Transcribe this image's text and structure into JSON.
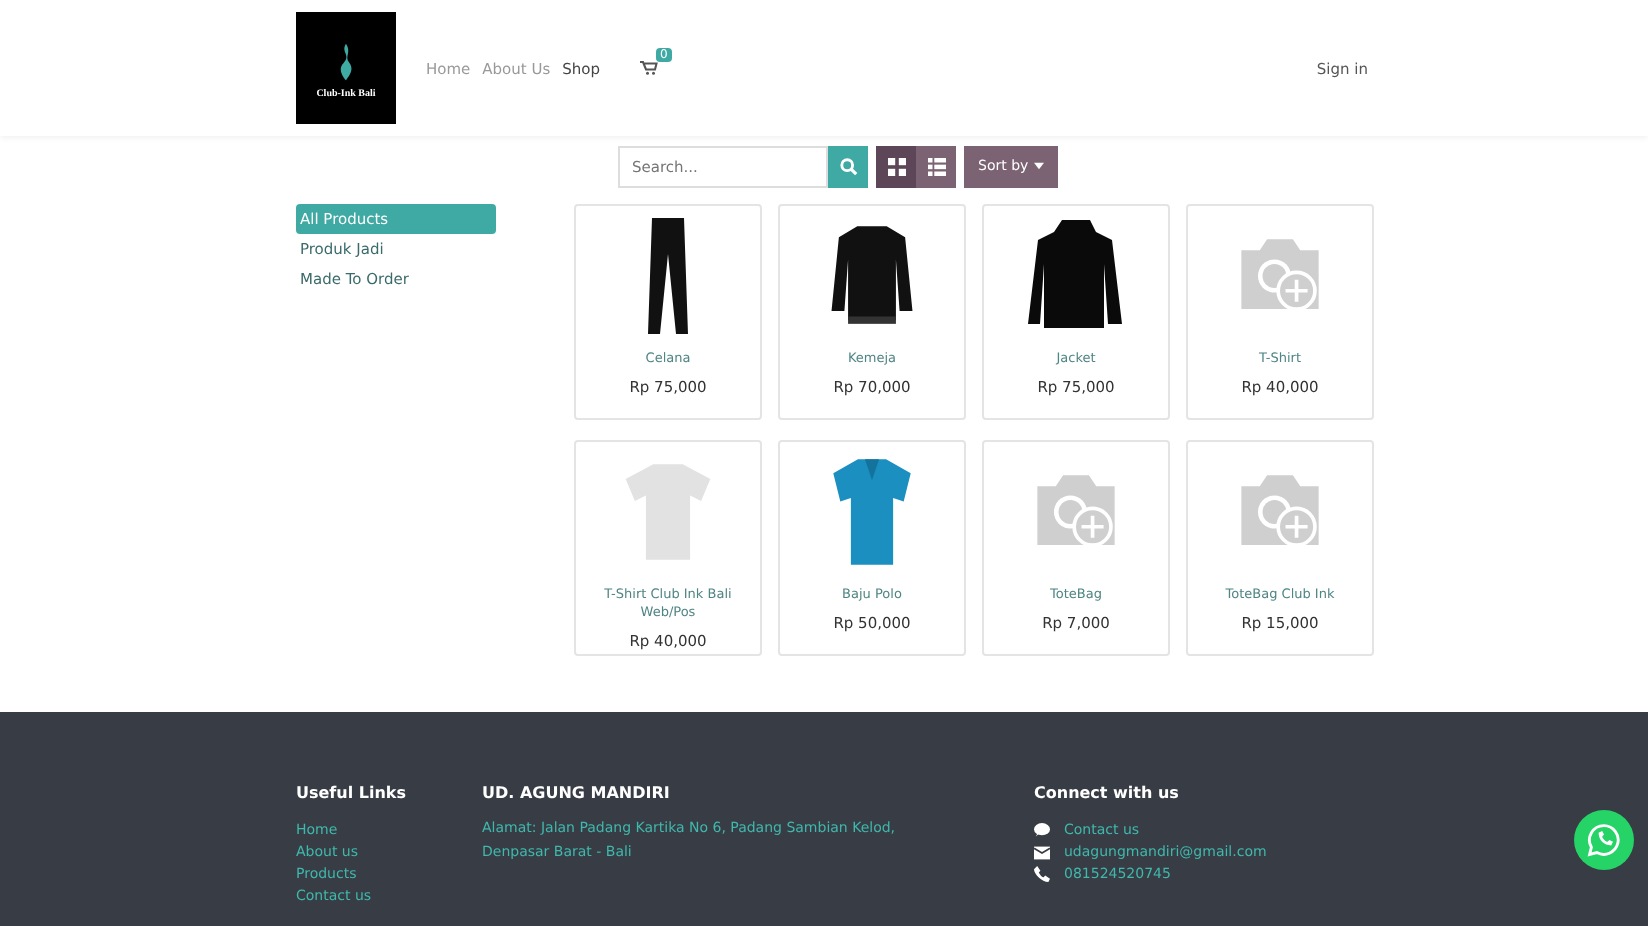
{
  "header": {
    "logo_text": "Club-Ink Bali",
    "nav": [
      {
        "label": "Home",
        "selected": false
      },
      {
        "label": "About Us",
        "selected": false
      },
      {
        "label": "Shop",
        "selected": true
      }
    ],
    "cart_count": "0",
    "sign_in": "Sign in"
  },
  "toolbar": {
    "search": {
      "placeholder": "Search..."
    },
    "views": [
      {
        "kind": "grid",
        "selected": true
      },
      {
        "kind": "list",
        "selected": false
      }
    ],
    "sort": "Sort by"
  },
  "categories": [
    {
      "label": "All Products",
      "selected": true
    },
    {
      "label": "Produk Jadi",
      "selected": false
    },
    {
      "label": "Made To Order",
      "selected": false
    }
  ],
  "products": [
    {
      "name": "Celana",
      "price": "Rp 75,000",
      "kind": "pants"
    },
    {
      "name": "Kemeja",
      "price": "Rp 70,000",
      "kind": "shirt"
    },
    {
      "name": "Jacket",
      "price": "Rp 75,000",
      "kind": "jacket"
    },
    {
      "name": "T-Shirt",
      "price": "Rp 40,000",
      "kind": "placeholder"
    },
    {
      "name": "T-Shirt Club Ink Bali Web/Pos",
      "price": "Rp 40,000",
      "kind": "tshirt"
    },
    {
      "name": "Baju Polo",
      "price": "Rp 50,000",
      "kind": "polo"
    },
    {
      "name": "ToteBag",
      "price": "Rp 7,000",
      "kind": "placeholder"
    },
    {
      "name": "ToteBag Club Ink",
      "price": "Rp 15,000",
      "kind": "placeholder"
    }
  ],
  "footer": {
    "useful_links": {
      "title": "Useful Links",
      "links": [
        "Home",
        "About us",
        "Products",
        "Contact us"
      ]
    },
    "company": {
      "title": "UD. AGUNG MANDIRI",
      "address": "Alamat: Jalan Padang Kartika No 6, Padang Sambian Kelod, Denpasar Barat - Bali"
    },
    "connect": {
      "title": "Connect with us",
      "items": [
        {
          "kind": "chat",
          "text": "Contact us"
        },
        {
          "kind": "email",
          "text": "udagungmandiri@gmail.com"
        },
        {
          "kind": "phone",
          "text": "081524520745"
        }
      ]
    }
  }
}
